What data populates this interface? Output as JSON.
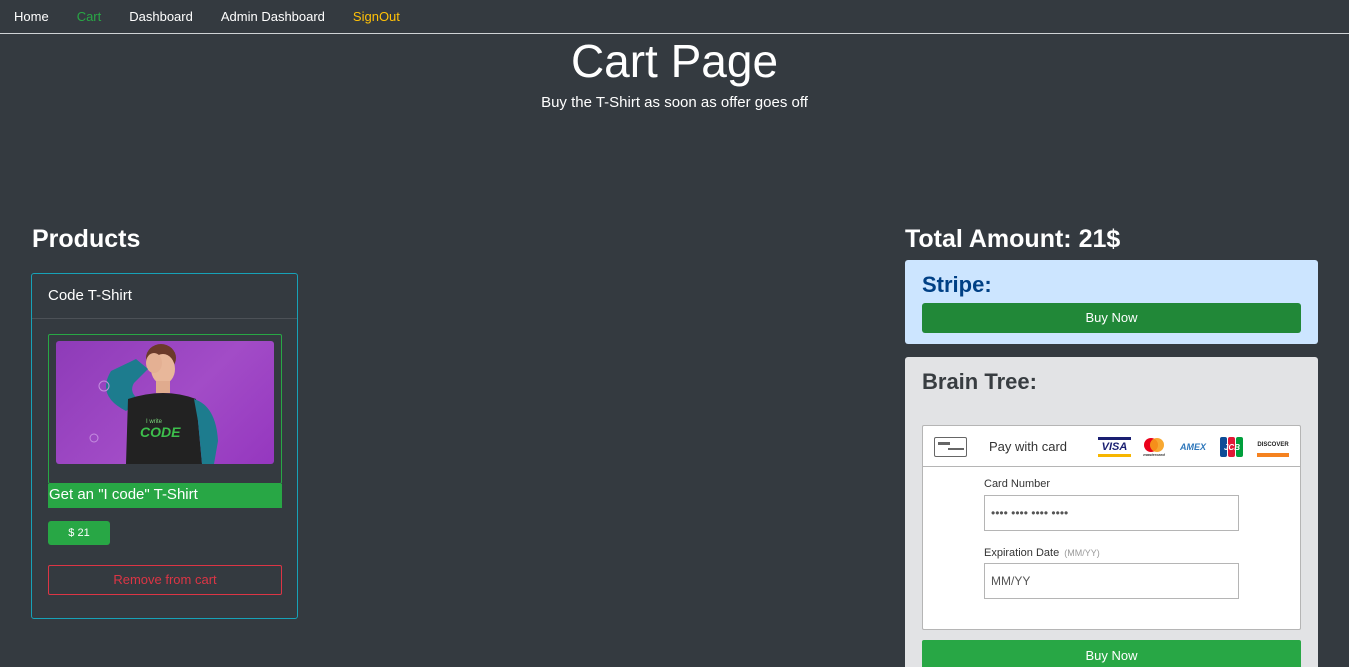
{
  "nav": {
    "items": [
      {
        "label": "Home",
        "state": "default"
      },
      {
        "label": "Cart",
        "state": "active"
      },
      {
        "label": "Dashboard",
        "state": "default"
      },
      {
        "label": "Admin Dashboard",
        "state": "default"
      },
      {
        "label": "SignOut",
        "state": "warning"
      }
    ],
    "colors": {
      "active": "#28a745",
      "signout": "#ffc107"
    }
  },
  "header": {
    "title": "Cart Page",
    "subtitle": "Buy the T-Shirt as soon as offer goes off"
  },
  "products": {
    "heading": "Products",
    "items": [
      {
        "name": "Code T-Shirt",
        "description": "Get an \"I code\" T-Shirt",
        "price": "$ 21",
        "remove_label": "Remove from cart",
        "image_alt_icon": "tshirt-photo"
      }
    ]
  },
  "checkout": {
    "total_label": "Total Amount: 21$",
    "stripe": {
      "title": "Stripe:",
      "button_label": "Buy Now"
    },
    "braintree": {
      "title": "Brain Tree:",
      "pay_with_card": "Pay with card",
      "card_brands": {
        "visa": "VISA",
        "mastercard": "mastercard",
        "amex": "AMEX",
        "jcb": "JCB",
        "discover": "DISCOVER"
      },
      "card_number_label": "Card Number",
      "card_number_value": "•••• •••• •••• ••••",
      "expiration_label": "Expiration Date",
      "expiration_hint": "(MM/YY)",
      "expiration_placeholder": "MM/YY",
      "button_label": "Buy Now"
    }
  }
}
